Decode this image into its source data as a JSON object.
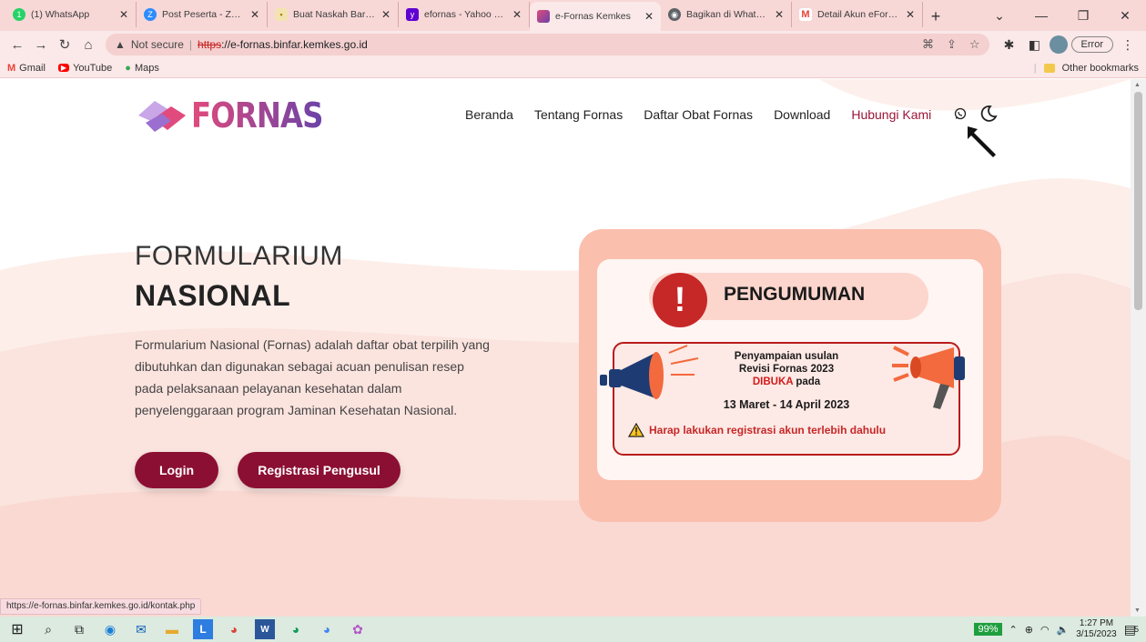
{
  "browser": {
    "tabs": [
      {
        "label": "(1) WhatsApp",
        "icon": "whatsapp-icon",
        "color": "#25d366"
      },
      {
        "label": "Post Peserta - Zoom",
        "icon": "zoom-icon",
        "color": "#2d8cff"
      },
      {
        "label": "Buat Naskah Baru - SI",
        "icon": "doc-icon",
        "color": "#d8a200"
      },
      {
        "label": "efornas - Yahoo Search",
        "icon": "yahoo-icon",
        "color": "#6001d2"
      },
      {
        "label": "e-Fornas Kemkes",
        "icon": "fornas-icon",
        "color": "#c2457a",
        "active": true
      },
      {
        "label": "Bagikan di WhatsApp",
        "icon": "globe-icon",
        "color": "#5f6368"
      },
      {
        "label": "Detail Akun eFornas",
        "icon": "gmail-icon",
        "color": "#ea4335"
      }
    ],
    "address": {
      "security": "Not secure",
      "protocol": "https",
      "host": "://e-fornas.binfar.kemkes.go.id"
    },
    "error_button": "Error",
    "bookmarks": [
      {
        "label": "Gmail",
        "icon": "gmail-icon"
      },
      {
        "label": "YouTube",
        "icon": "youtube-icon"
      },
      {
        "label": "Maps",
        "icon": "maps-icon"
      }
    ],
    "other_bookmarks": "Other bookmarks",
    "status_url": "https://e-fornas.binfar.kemkes.go.id/kontak.php"
  },
  "site": {
    "logo": "FORNAS",
    "nav": [
      "Beranda",
      "Tentang Fornas",
      "Daftar Obat Fornas",
      "Download",
      "Hubungi Kami"
    ],
    "active_nav": "Hubungi Kami",
    "hero_title_line1": "FORMULARIUM",
    "hero_title_line2": "NASIONAL",
    "hero_desc": "Formularium Nasional (Fornas) adalah daftar obat terpilih yang dibutuhkan dan digunakan sebagai acuan penulisan resep pada pelaksanaan pelayanan kesehatan dalam penyelenggaraan program Jaminan Kesehatan Nasional.",
    "login_button": "Login",
    "register_button": "Registrasi Pengusul",
    "announcement": {
      "title": "PENGUMUMAN",
      "line1": "Penyampaian usulan",
      "line2": "Revisi Fornas 2023",
      "line3_red": "DIBUKA",
      "line3_rest": " pada",
      "dates": "13 Maret - 14 April 2023",
      "warning": "Harap lakukan registrasi akun terlebih dahulu"
    }
  },
  "taskbar": {
    "battery": "99%",
    "time": "1:27 PM",
    "date": "3/15/2023",
    "notifications": "5"
  },
  "colors": {
    "brand": "#8b0f33",
    "tabstrip": "#f8d7d7"
  }
}
